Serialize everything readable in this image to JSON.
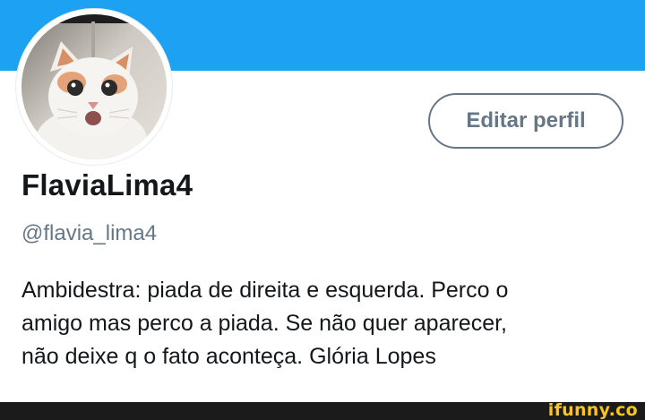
{
  "profile": {
    "display_name": "FlaviaLima4",
    "handle": "@flavia_lima4",
    "bio_lines": [
      "Ambidestra: piada de direita e esquerda. Perco o",
      "amigo mas perco a piada. Se não quer aparecer,",
      "não deixe q o fato aconteça. Glória Lopes"
    ]
  },
  "actions": {
    "edit_profile_label": "Editar perfil"
  },
  "avatar": {
    "icon": "cat-photo-avatar"
  },
  "watermark": {
    "text": "ifunny.co"
  },
  "colors": {
    "banner": "#1da1f2",
    "muted_text": "#657786",
    "primary_text": "#14171a",
    "watermark": "#f7c51d"
  }
}
